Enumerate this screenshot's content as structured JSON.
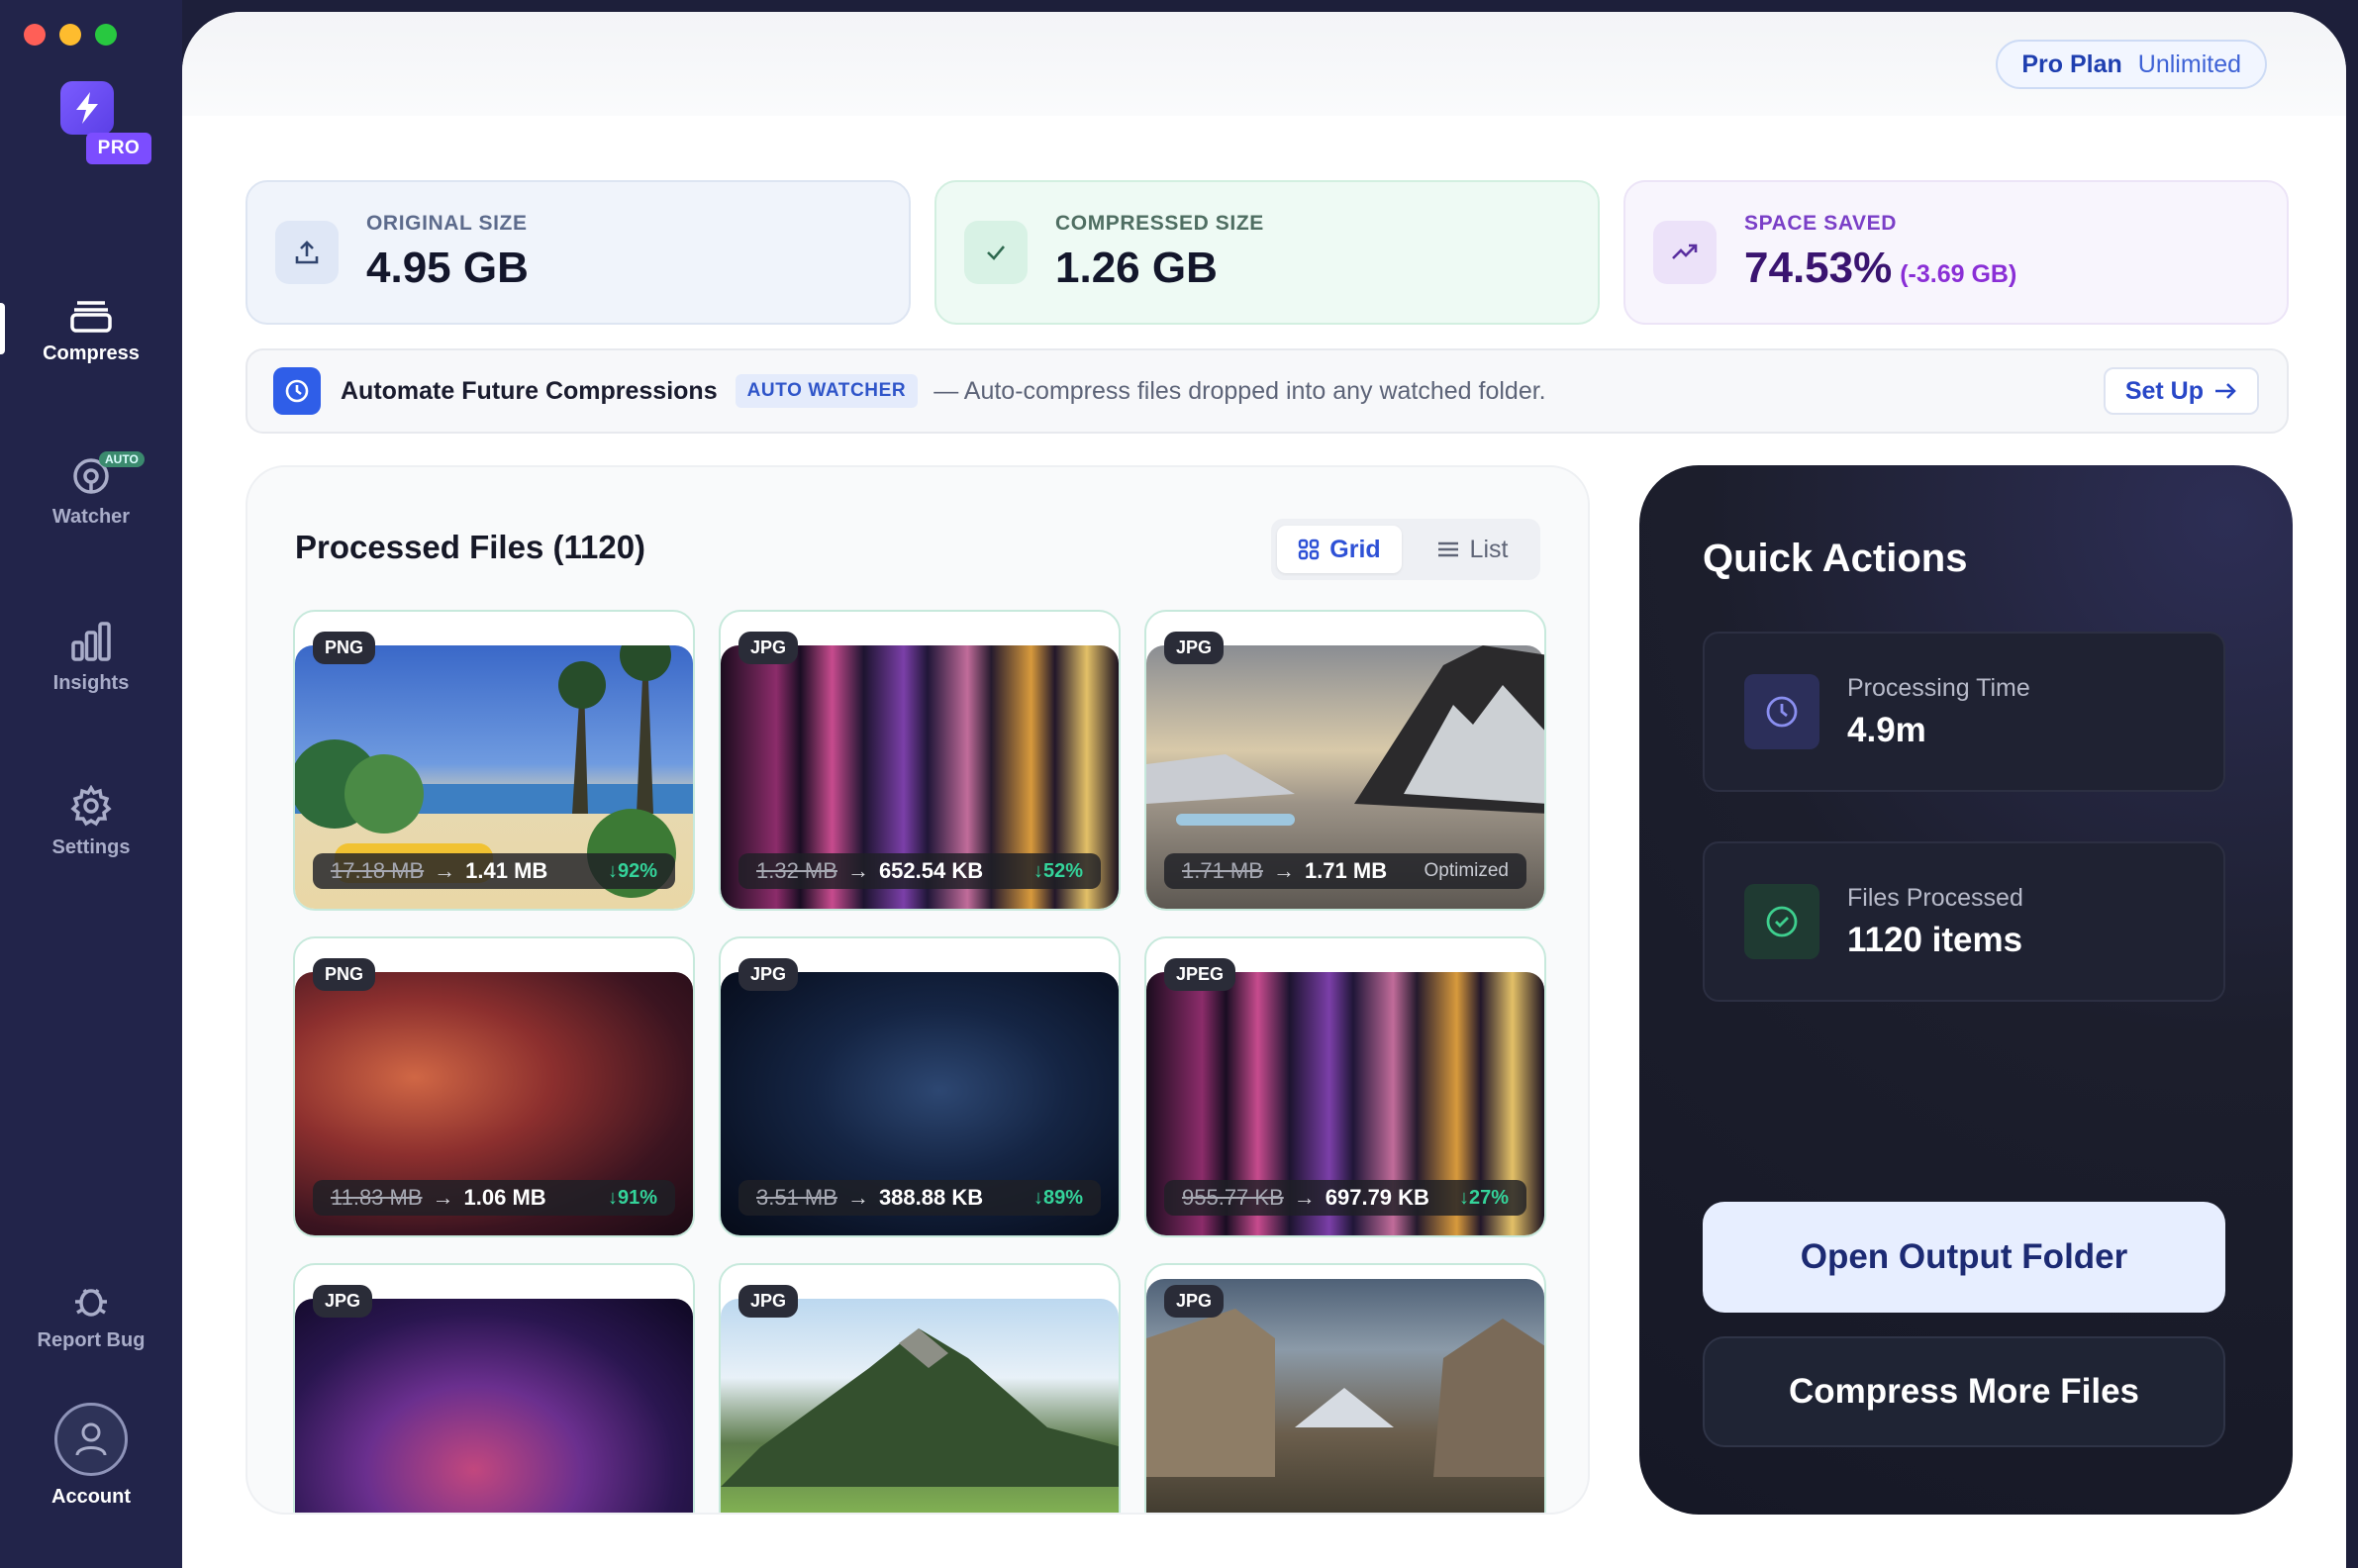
{
  "sidebar": {
    "badge": "PRO",
    "nav": [
      {
        "label": "Compress",
        "icon": "stack-icon"
      },
      {
        "label": "Watcher",
        "icon": "watcher-icon",
        "tag": "AUTO"
      },
      {
        "label": "Insights",
        "icon": "bar-chart-icon"
      },
      {
        "label": "Settings",
        "icon": "gear-icon"
      },
      {
        "label": "Report Bug",
        "icon": "bug-icon"
      },
      {
        "label": "Account",
        "icon": "user-icon"
      }
    ]
  },
  "plan": {
    "name": "Pro Plan",
    "tier": "Unlimited"
  },
  "stats": {
    "original": {
      "label": "ORIGINAL SIZE",
      "value": "4.95 GB"
    },
    "compressed": {
      "label": "COMPRESSED SIZE",
      "value": "1.26 GB"
    },
    "saved": {
      "label": "SPACE SAVED",
      "value": "74.53%",
      "sub": "(-3.69 GB)"
    }
  },
  "automate": {
    "title": "Automate Future Compressions",
    "tag": "AUTO WATCHER",
    "desc": "— Auto-compress files dropped into any watched folder.",
    "button": "Set Up"
  },
  "files": {
    "title": "Processed Files (1120)",
    "views": {
      "grid": "Grid",
      "list": "List"
    },
    "arrow": "→",
    "items": [
      {
        "format": "PNG",
        "old": "17.18 MB",
        "new": "1.41 MB",
        "pct": "↓92%"
      },
      {
        "format": "JPG",
        "old": "1.32 MB",
        "new": "652.54 KB",
        "pct": "↓52%"
      },
      {
        "format": "JPG",
        "old": "1.71 MB",
        "new": "1.71 MB",
        "status": "Optimized"
      },
      {
        "format": "PNG",
        "old": "11.83 MB",
        "new": "1.06 MB",
        "pct": "↓91%"
      },
      {
        "format": "JPG",
        "old": "3.51 MB",
        "new": "388.88 KB",
        "pct": "↓89%"
      },
      {
        "format": "JPEG",
        "old": "955.77 KB",
        "new": "697.79 KB",
        "pct": "↓27%"
      },
      {
        "format": "JPG"
      },
      {
        "format": "JPG"
      },
      {
        "format": "JPG"
      }
    ]
  },
  "quick_actions": {
    "title": "Quick Actions",
    "processing": {
      "label": "Processing Time",
      "value": "4.9m"
    },
    "processed": {
      "label": "Files Processed",
      "value": "1120 items"
    },
    "open_button": "Open Output Folder",
    "more_button": "Compress More Files"
  }
}
